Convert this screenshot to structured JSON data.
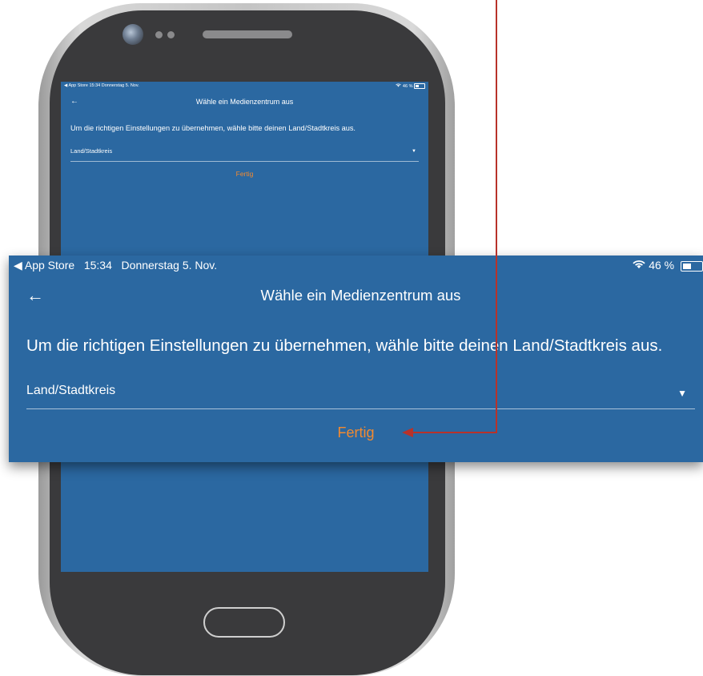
{
  "status_bar": {
    "back_app": "◀ App Store",
    "time": "15:34",
    "date": "Donnerstag 5. Nov.",
    "battery": "46 %"
  },
  "header": {
    "back_icon": "arrow-left-icon",
    "title": "Wähle ein Medienzentrum aus"
  },
  "main": {
    "instruction": "Um die richtigen Einstellungen zu übernehmen, wähle bitte deinen Land/Stadtkreis aus.",
    "select_label": "Land/Stadtkreis",
    "done_label": "Fertig"
  },
  "colors": {
    "screen_background": "#2b68a1",
    "accent_orange": "#f28a30",
    "annotation_red": "#b8322a"
  }
}
